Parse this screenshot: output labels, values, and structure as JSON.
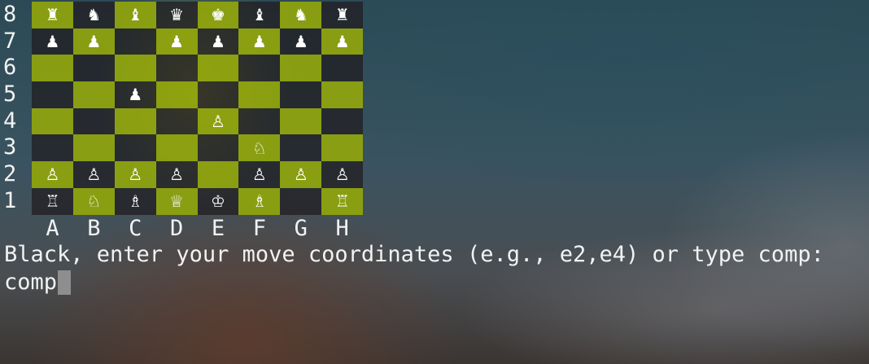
{
  "board": {
    "ranks": [
      "8",
      "7",
      "6",
      "5",
      "4",
      "3",
      "2",
      "1"
    ],
    "files": [
      "A",
      "B",
      "C",
      "D",
      "E",
      "F",
      "G",
      "H"
    ],
    "squares": [
      [
        "♜",
        "♞",
        "♝",
        "♛",
        "♚",
        "♝",
        "♞",
        "♜"
      ],
      [
        "♟",
        "♟",
        "",
        "♟",
        "♟",
        "♟",
        "♟",
        "♟"
      ],
      [
        "",
        "",
        "",
        "",
        "",
        "",
        "",
        ""
      ],
      [
        "",
        "",
        "♟",
        "",
        "",
        "",
        "",
        ""
      ],
      [
        "",
        "",
        "",
        "",
        "♙",
        "",
        "",
        ""
      ],
      [
        "",
        "",
        "",
        "",
        "",
        "♘",
        "",
        ""
      ],
      [
        "♙",
        "♙",
        "♙",
        "♙",
        "",
        "♙",
        "♙",
        "♙"
      ],
      [
        "♖",
        "♘",
        "♗",
        "♕",
        "♔",
        "♗",
        "",
        "♖"
      ]
    ],
    "colors": {
      "light_square": "#92a60a",
      "dark_square": "#201c1e"
    }
  },
  "terminal": {
    "prompt": "Black, enter your move coordinates (e.g., e2,e4) or type comp:",
    "input_value": "comp"
  }
}
